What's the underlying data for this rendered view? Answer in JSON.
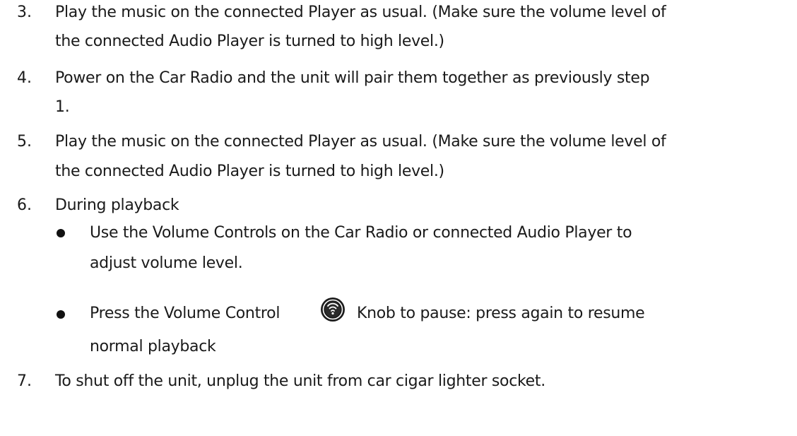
{
  "steps": [
    {
      "number": "3.",
      "lines": [
        "Play the music on the connected Player as usual. (Make sure the volume level of",
        "the connected Audio Player is turned to high level.)"
      ]
    },
    {
      "number": "4.",
      "lines": [
        "Power on the Car Radio and the unit will pair them together as previously step",
        "1."
      ]
    },
    {
      "number": "5.",
      "lines": [
        "Play the music on the connected Player as usual. (Make sure the volume level of",
        "the connected Audio Player is turned to high level.)"
      ]
    },
    {
      "number": "6.",
      "lines": [
        "During playback"
      ],
      "bullets": [
        {
          "lines": [
            "Use the Volume Controls on the Car Radio or connected Audio Player to",
            "adjust volume level."
          ]
        },
        {
          "before_icon": "Press the Volume Control",
          "icon": "volume-knob-icon",
          "after_icon": "Knob to pause: press again to resume",
          "continuation": "normal playback"
        }
      ]
    },
    {
      "number": "7.",
      "lines": [
        "To shut off the unit, unplug the unit from car cigar lighter socket."
      ]
    }
  ]
}
